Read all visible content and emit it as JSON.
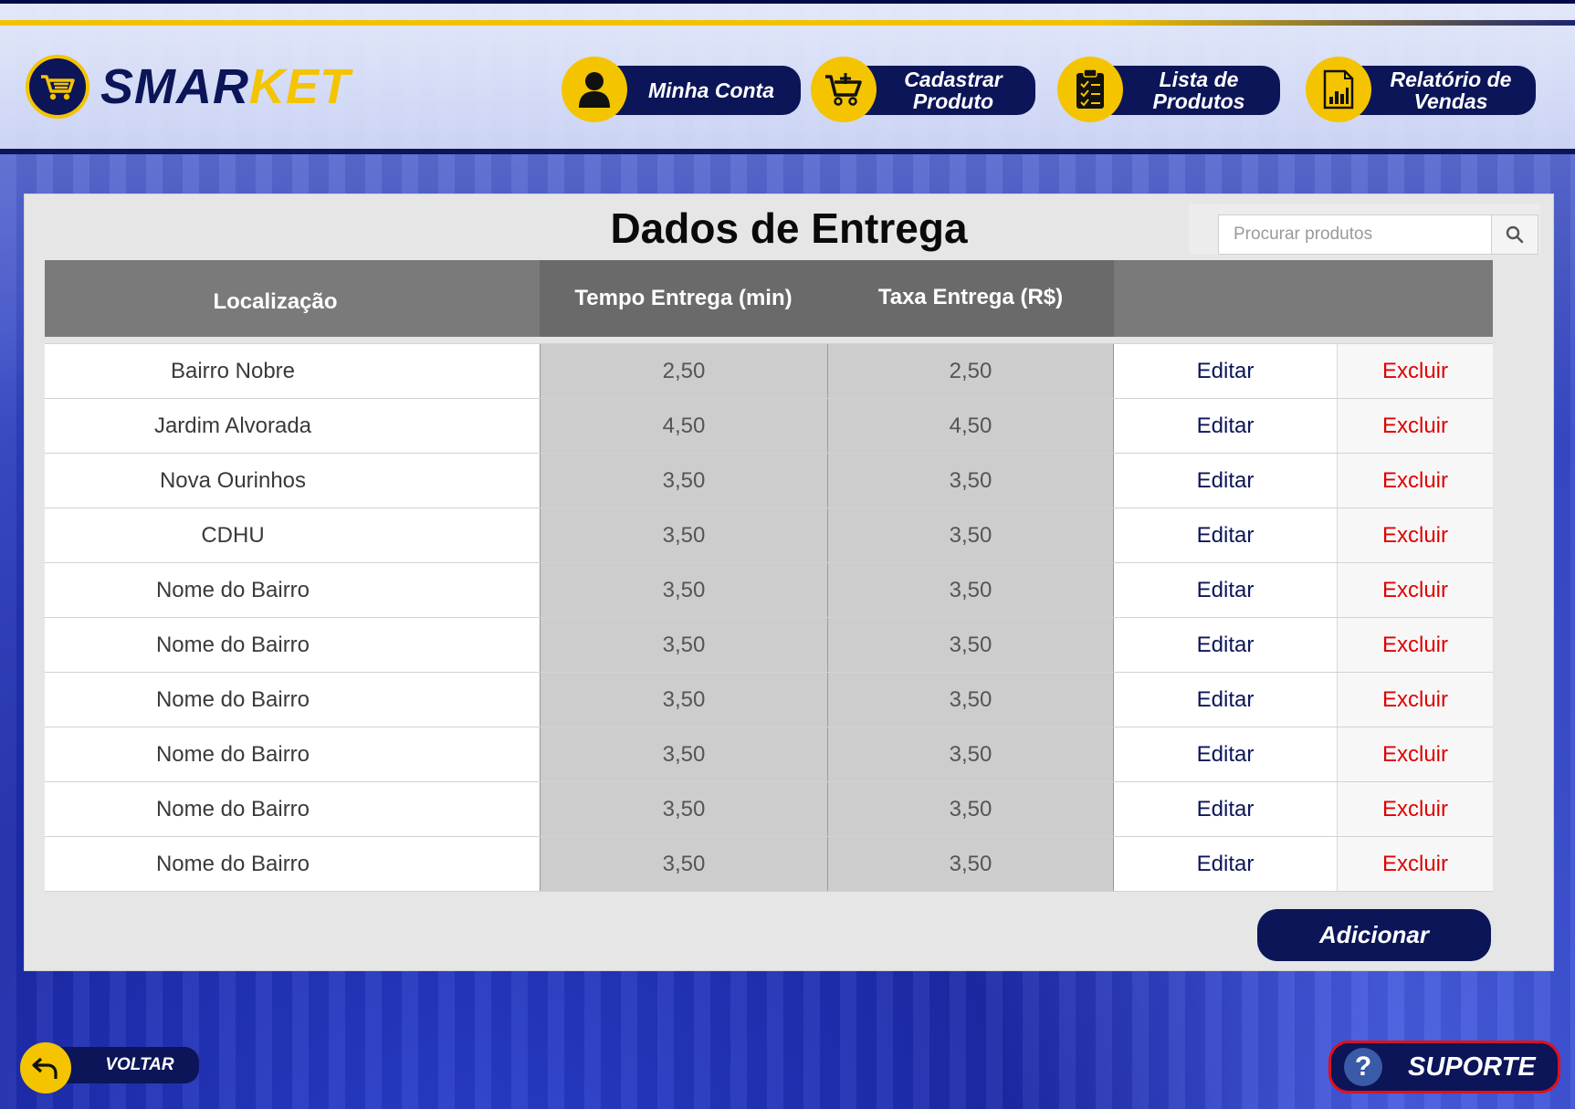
{
  "brand": {
    "part1": "SMAR",
    "part2": "KET"
  },
  "nav": [
    {
      "label": "Minha Conta",
      "icon": "user-icon"
    },
    {
      "label": "Cadastrar Produto",
      "icon": "cart-add-icon"
    },
    {
      "label": "Lista de Produtos",
      "icon": "clipboard-list-icon"
    },
    {
      "label": "Relatório de Vendas",
      "icon": "report-chart-icon"
    }
  ],
  "page": {
    "title": "Dados de Entrega"
  },
  "search": {
    "placeholder": "Procurar produtos",
    "value": ""
  },
  "table": {
    "headers": [
      "Localização",
      "Tempo Entrega (min)",
      "Taxa Entrega (R$)"
    ],
    "rows": [
      {
        "location": "Bairro Nobre",
        "time": "2,50",
        "fee": "2,50",
        "edit": "Editar",
        "delete": "Excluir"
      },
      {
        "location": "Jardim Alvorada",
        "time": "4,50",
        "fee": "4,50",
        "edit": "Editar",
        "delete": "Excluir"
      },
      {
        "location": "Nova Ourinhos",
        "time": "3,50",
        "fee": "3,50",
        "edit": "Editar",
        "delete": "Excluir"
      },
      {
        "location": "CDHU",
        "time": "3,50",
        "fee": "3,50",
        "edit": "Editar",
        "delete": "Excluir"
      },
      {
        "location": "Nome do Bairro",
        "time": "3,50",
        "fee": "3,50",
        "edit": "Editar",
        "delete": "Excluir"
      },
      {
        "location": "Nome do Bairro",
        "time": "3,50",
        "fee": "3,50",
        "edit": "Editar",
        "delete": "Excluir"
      },
      {
        "location": "Nome do Bairro",
        "time": "3,50",
        "fee": "3,50",
        "edit": "Editar",
        "delete": "Excluir"
      },
      {
        "location": "Nome do Bairro",
        "time": "3,50",
        "fee": "3,50",
        "edit": "Editar",
        "delete": "Excluir"
      },
      {
        "location": "Nome do Bairro",
        "time": "3,50",
        "fee": "3,50",
        "edit": "Editar",
        "delete": "Excluir"
      },
      {
        "location": "Nome do Bairro",
        "time": "3,50",
        "fee": "3,50",
        "edit": "Editar",
        "delete": "Excluir"
      }
    ]
  },
  "actions": {
    "add_label": "Adicionar"
  },
  "footer": {
    "back_label": "VOLTAR",
    "support_label": "SUPORTE",
    "support_icon": "?"
  },
  "colors": {
    "navy": "#0b1558",
    "gold": "#f4c400",
    "danger": "#e00000",
    "header_gray": "#7a7a7a",
    "cell_gray": "#cdcdcd"
  }
}
